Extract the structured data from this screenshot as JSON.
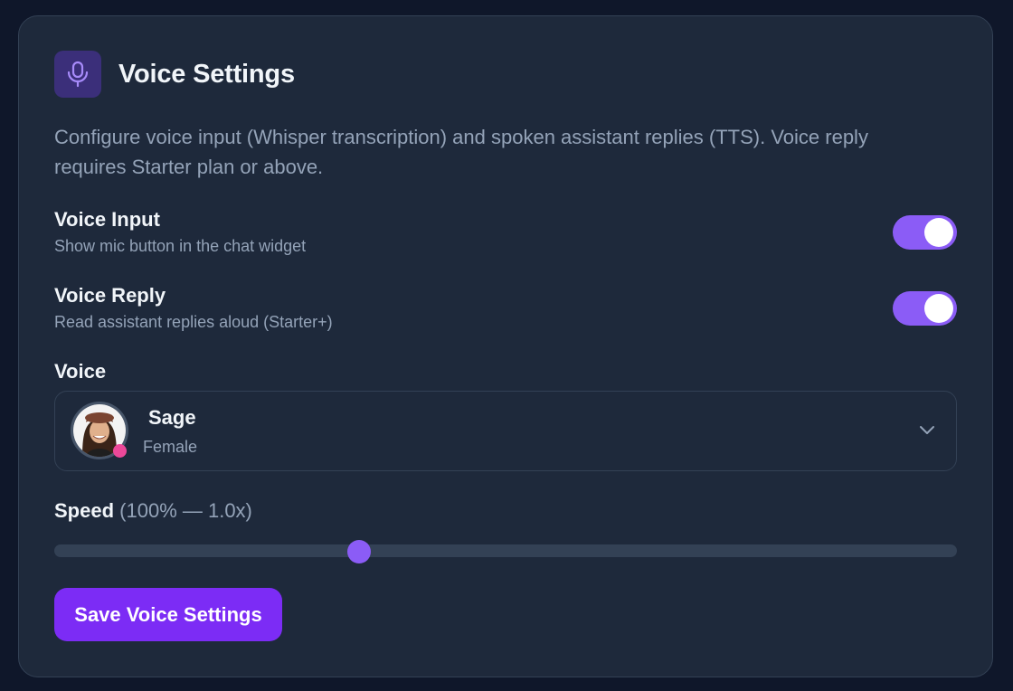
{
  "header": {
    "title": "Voice Settings",
    "icon": "microphone-icon"
  },
  "description": "Configure voice input (Whisper transcription) and spoken assistant replies (TTS). Voice reply requires Starter plan or above.",
  "settings": [
    {
      "title": "Voice Input",
      "subtitle": "Show mic button in the chat widget",
      "enabled": true
    },
    {
      "title": "Voice Reply",
      "subtitle": "Read assistant replies aloud (Starter+)",
      "enabled": true
    }
  ],
  "voice": {
    "label": "Voice",
    "selected_name": "Sage",
    "selected_gender": "Female",
    "status_color": "#ec4899"
  },
  "speed": {
    "label": "Speed",
    "value_text": "(100% — 1.0x)",
    "slider_fraction": 0.338
  },
  "save_button": {
    "label": "Save Voice Settings"
  },
  "colors": {
    "accent": "#8b5cf6",
    "button": "#7c2cf5",
    "background": "#0f172a",
    "card": "#1e293b"
  }
}
